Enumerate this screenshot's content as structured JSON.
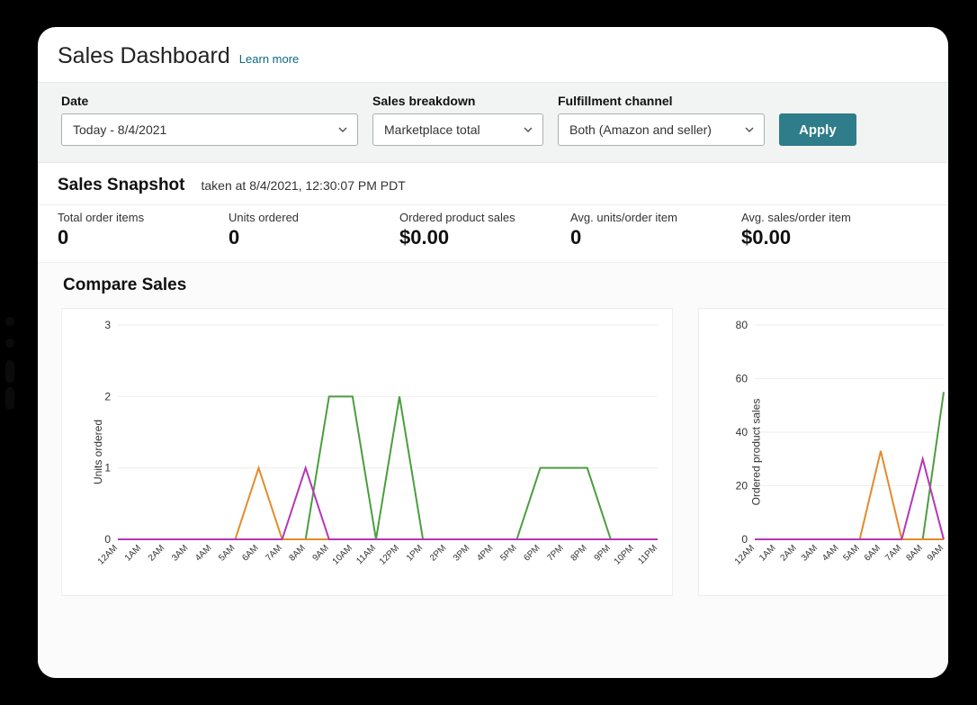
{
  "header": {
    "title": "Sales Dashboard",
    "learn_more": "Learn more"
  },
  "filters": {
    "date_label": "Date",
    "date_value": "Today - 8/4/2021",
    "breakdown_label": "Sales breakdown",
    "breakdown_value": "Marketplace total",
    "channel_label": "Fulfillment channel",
    "channel_value": "Both (Amazon and seller)",
    "apply": "Apply"
  },
  "snapshot": {
    "heading": "Sales Snapshot",
    "taken_at": "taken at 8/4/2021, 12:30:07 PM PDT",
    "metrics": {
      "total_order_items": {
        "label": "Total order items",
        "value": "0"
      },
      "units_ordered": {
        "label": "Units ordered",
        "value": "0"
      },
      "ordered_sales": {
        "label": "Ordered product sales",
        "value": "$0.00"
      },
      "avg_units": {
        "label": "Avg. units/order item",
        "value": "0"
      },
      "avg_sales": {
        "label": "Avg. sales/order item",
        "value": "$0.00"
      }
    }
  },
  "compare": {
    "heading": "Compare Sales"
  },
  "colors": {
    "green": "#4b9e3e",
    "orange": "#e38b2a",
    "purple": "#b536b8",
    "apply": "#2f7c8a"
  },
  "chart_data": [
    {
      "type": "line",
      "title": "",
      "xlabel": "",
      "ylabel": "Units ordered",
      "ylim": [
        0,
        3
      ],
      "yticks": [
        0,
        1,
        2,
        3
      ],
      "categories": [
        "12AM",
        "1AM",
        "2AM",
        "3AM",
        "4AM",
        "5AM",
        "6AM",
        "7AM",
        "8AM",
        "9AM",
        "10AM",
        "11AM",
        "12PM",
        "1PM",
        "2PM",
        "3PM",
        "4PM",
        "5PM",
        "6PM",
        "7PM",
        "8PM",
        "9PM",
        "10PM",
        "11PM"
      ],
      "series": [
        {
          "name": "green",
          "color": "green",
          "values": [
            0,
            0,
            0,
            0,
            0,
            0,
            0,
            0,
            0,
            2,
            2,
            0,
            2,
            0,
            0,
            0,
            0,
            0,
            1,
            1,
            1,
            0,
            0,
            0
          ]
        },
        {
          "name": "orange",
          "color": "orange",
          "values": [
            0,
            0,
            0,
            0,
            0,
            0,
            1,
            0,
            0,
            0,
            0,
            0,
            0,
            0,
            0,
            0,
            0,
            0,
            0,
            0,
            0,
            0,
            0,
            0
          ]
        },
        {
          "name": "purple",
          "color": "purple",
          "values": [
            0,
            0,
            0,
            0,
            0,
            0,
            0,
            0,
            1,
            0,
            0,
            0,
            0,
            0,
            0,
            0,
            0,
            0,
            0,
            0,
            0,
            0,
            0,
            0
          ]
        }
      ]
    },
    {
      "type": "line",
      "title": "",
      "xlabel": "",
      "ylabel": "Ordered product sales",
      "ylim": [
        0,
        80
      ],
      "yticks": [
        0,
        20,
        40,
        60,
        80
      ],
      "categories": [
        "12AM",
        "1AM",
        "2AM",
        "3AM",
        "4AM",
        "5AM",
        "6AM",
        "7AM",
        "8AM",
        "9AM"
      ],
      "series": [
        {
          "name": "green",
          "color": "green",
          "values": [
            0,
            0,
            0,
            0,
            0,
            0,
            0,
            0,
            0,
            55
          ]
        },
        {
          "name": "orange",
          "color": "orange",
          "values": [
            0,
            0,
            0,
            0,
            0,
            0,
            33,
            0,
            0,
            0
          ]
        },
        {
          "name": "purple",
          "color": "purple",
          "values": [
            0,
            0,
            0,
            0,
            0,
            0,
            0,
            0,
            30,
            0
          ]
        }
      ]
    }
  ]
}
